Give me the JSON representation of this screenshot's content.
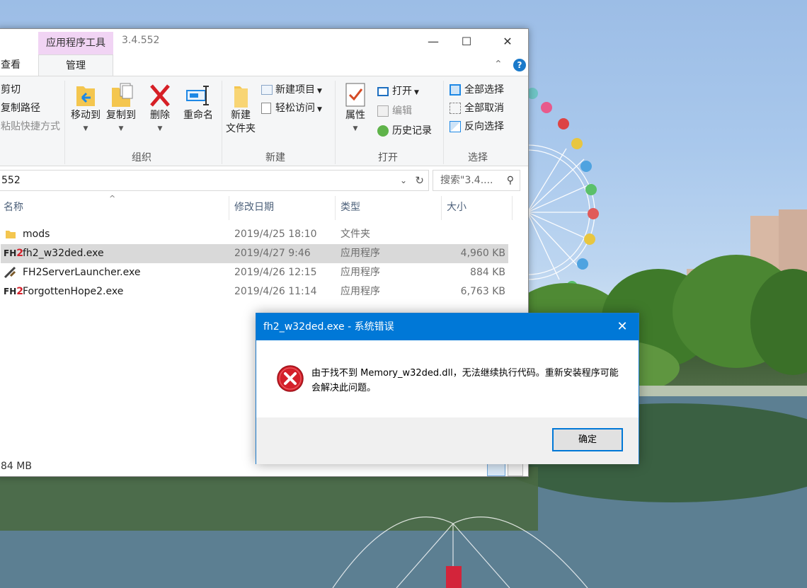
{
  "explorer": {
    "context_tab": "应用程序工具",
    "title": "3.4.552",
    "tabs": {
      "view": "查看",
      "manage": "管理"
    },
    "ribbon": {
      "clipboard": {
        "cut": "剪切",
        "copy_path": "复制路径",
        "paste_shortcut": "粘贴快捷方式"
      },
      "organize": {
        "label": "组织",
        "move_to": "移动到",
        "copy_to": "复制到",
        "delete": "删除",
        "rename": "重命名"
      },
      "new": {
        "label": "新建",
        "new_folder_line1": "新建",
        "new_folder_line2": "文件夹",
        "new_item": "新建项目",
        "easy_access": "轻松访问"
      },
      "open": {
        "label": "打开",
        "properties": "属性",
        "open": "打开",
        "edit": "编辑",
        "history": "历史记录"
      },
      "select": {
        "label": "选择",
        "select_all": "全部选择",
        "select_none": "全部取消",
        "invert": "反向选择"
      }
    },
    "address": "552",
    "search_placeholder": "搜索\"3.4....",
    "columns": {
      "name": "名称",
      "date": "修改日期",
      "type": "类型",
      "size": "大小"
    },
    "files": [
      {
        "name": "mods",
        "date": "2019/4/25 18:10",
        "type": "文件夹",
        "size": "",
        "icon": "folder-icon"
      },
      {
        "name": "fh2_w32ded.exe",
        "date": "2019/4/27 9:46",
        "type": "应用程序",
        "size": "4,960 KB",
        "icon": "fh2-icon"
      },
      {
        "name": "FH2ServerLauncher.exe",
        "date": "2019/4/26 12:15",
        "type": "应用程序",
        "size": "884 KB",
        "icon": "launcher-icon"
      },
      {
        "name": "ForgottenHope2.exe",
        "date": "2019/4/26 11:14",
        "type": "应用程序",
        "size": "6,763 KB",
        "icon": "fh2-icon"
      }
    ],
    "status": "84 MB"
  },
  "dialog": {
    "title": "fh2_w32ded.exe - 系统错误",
    "message": "由于找不到 Memory_w32ded.dll，无法继续执行代码。重新安装程序可能会解决此问题。",
    "ok": "确定",
    "icon": "error-icon"
  },
  "colors": {
    "accent": "#0078d7",
    "context_tab": "#f1d4f4",
    "selected_row": "#d9d9d9",
    "error_red": "#d4202a"
  }
}
